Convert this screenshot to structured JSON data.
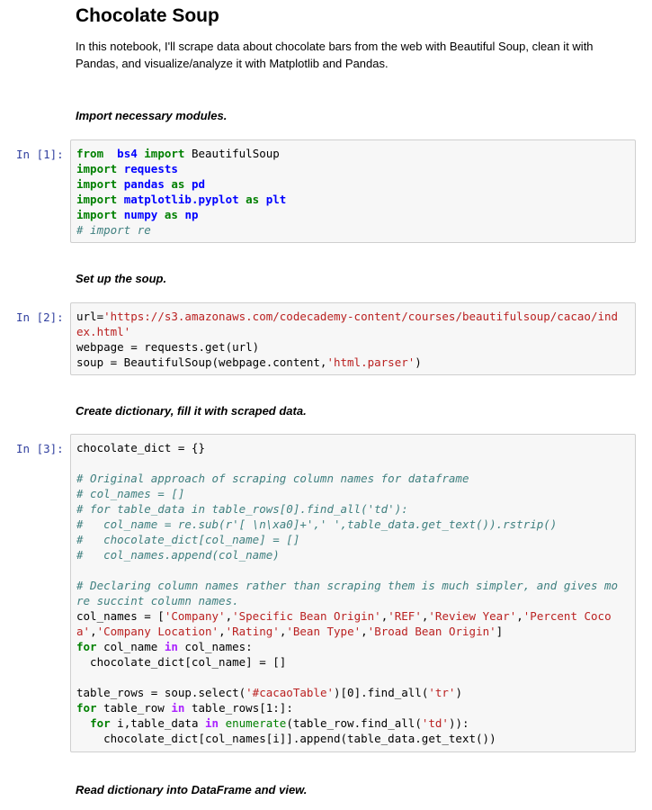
{
  "title": "Chocolate Soup",
  "intro": "In this notebook, I'll scrape data about chocolate bars from the web with Beautiful Soup, clean it with Pandas, and visualize/analyze it with Matplotlib and Pandas.",
  "headings": {
    "import": "Import necessary modules.",
    "soup": "Set up the soup.",
    "dict": "Create dictionary, fill it with scraped data.",
    "read": "Read dictionary into DataFrame and view."
  },
  "cells": [
    {
      "prompt": "In [1]:",
      "lines": [
        [
          [
            "kw",
            "from"
          ],
          [
            "",
            "  "
          ],
          [
            "mod",
            "bs4"
          ],
          [
            "",
            " "
          ],
          [
            "kw",
            "import"
          ],
          [
            "",
            " BeautifulSoup"
          ]
        ],
        [
          [
            "kw",
            "import"
          ],
          [
            "",
            " "
          ],
          [
            "mod",
            "requests"
          ]
        ],
        [
          [
            "kw",
            "import"
          ],
          [
            "",
            " "
          ],
          [
            "mod",
            "pandas"
          ],
          [
            "",
            " "
          ],
          [
            "kw",
            "as"
          ],
          [
            "",
            " "
          ],
          [
            "mod",
            "pd"
          ]
        ],
        [
          [
            "kw",
            "import"
          ],
          [
            "",
            " "
          ],
          [
            "mod",
            "matplotlib.pyplot"
          ],
          [
            "",
            " "
          ],
          [
            "kw",
            "as"
          ],
          [
            "",
            " "
          ],
          [
            "mod",
            "plt"
          ]
        ],
        [
          [
            "kw",
            "import"
          ],
          [
            "",
            " "
          ],
          [
            "mod",
            "numpy"
          ],
          [
            "",
            " "
          ],
          [
            "kw",
            "as"
          ],
          [
            "",
            " "
          ],
          [
            "mod",
            "np"
          ]
        ],
        [
          [
            "cm",
            "# import re"
          ]
        ]
      ]
    },
    {
      "prompt": "In [2]:",
      "lines": [
        [
          [
            "",
            "url="
          ],
          [
            "str",
            "'https://s3.amazonaws.com/codecademy-content/courses/beautifulsoup/cacao/ind"
          ]
        ],
        [
          [
            "str",
            "ex.html'"
          ]
        ],
        [
          [
            "",
            "webpage = requests.get(url)"
          ]
        ],
        [
          [
            "",
            "soup = BeautifulSoup(webpage.content,"
          ],
          [
            "str",
            "'html.parser'"
          ],
          [
            "",
            ")"
          ]
        ]
      ]
    },
    {
      "prompt": "In [3]:",
      "lines": [
        [
          [
            "",
            "chocolate_dict = {}"
          ]
        ],
        [
          [
            "",
            ""
          ]
        ],
        [
          [
            "cm",
            "# Original approach of scraping column names for dataframe"
          ]
        ],
        [
          [
            "cm",
            "# col_names = []"
          ]
        ],
        [
          [
            "cm",
            "# for table_data in table_rows[0].find_all('td'):"
          ]
        ],
        [
          [
            "cm",
            "#   col_name = re.sub(r'[ \\n\\xa0]+',' ',table_data.get_text()).rstrip()"
          ]
        ],
        [
          [
            "cm",
            "#   chocolate_dict[col_name] = []"
          ]
        ],
        [
          [
            "cm",
            "#   col_names.append(col_name)"
          ]
        ],
        [
          [
            "",
            ""
          ]
        ],
        [
          [
            "cm",
            "# Declaring column names rather than scraping them is much simpler, and gives mo"
          ]
        ],
        [
          [
            "cm",
            "re succint column names."
          ]
        ],
        [
          [
            "",
            "col_names = ["
          ],
          [
            "str",
            "'Company'"
          ],
          [
            "",
            ","
          ],
          [
            "str",
            "'Specific Bean Origin'"
          ],
          [
            "",
            ","
          ],
          [
            "str",
            "'REF'"
          ],
          [
            "",
            ","
          ],
          [
            "str",
            "'Review Year'"
          ],
          [
            "",
            ","
          ],
          [
            "str",
            "'Percent Coco"
          ]
        ],
        [
          [
            "str",
            "a'"
          ],
          [
            "",
            ","
          ],
          [
            "str",
            "'Company Location'"
          ],
          [
            "",
            ","
          ],
          [
            "str",
            "'Rating'"
          ],
          [
            "",
            ","
          ],
          [
            "str",
            "'Bean Type'"
          ],
          [
            "",
            ","
          ],
          [
            "str",
            "'Broad Bean Origin'"
          ],
          [
            "",
            "]"
          ]
        ],
        [
          [
            "kw",
            "for"
          ],
          [
            "",
            " col_name "
          ],
          [
            "op",
            "in"
          ],
          [
            "",
            " col_names:"
          ]
        ],
        [
          [
            "",
            "  chocolate_dict[col_name] = []"
          ]
        ],
        [
          [
            "",
            ""
          ]
        ],
        [
          [
            "",
            "table_rows = soup.select("
          ],
          [
            "str",
            "'#cacaoTable'"
          ],
          [
            "",
            ")[0].find_all("
          ],
          [
            "str",
            "'tr'"
          ],
          [
            "",
            ")"
          ]
        ],
        [
          [
            "kw",
            "for"
          ],
          [
            "",
            " table_row "
          ],
          [
            "op",
            "in"
          ],
          [
            "",
            " table_rows[1:]:"
          ]
        ],
        [
          [
            "",
            "  "
          ],
          [
            "kw",
            "for"
          ],
          [
            "",
            " i,table_data "
          ],
          [
            "op",
            "in"
          ],
          [
            "",
            " "
          ],
          [
            "bi",
            "enumerate"
          ],
          [
            "",
            "(table_row.find_all("
          ],
          [
            "str",
            "'td'"
          ],
          [
            "",
            "))"
          ],
          [
            "",
            ":"
          ]
        ],
        [
          [
            "",
            "    chocolate_dict[col_names[i]].append(table_data.get_text())"
          ]
        ]
      ]
    }
  ]
}
